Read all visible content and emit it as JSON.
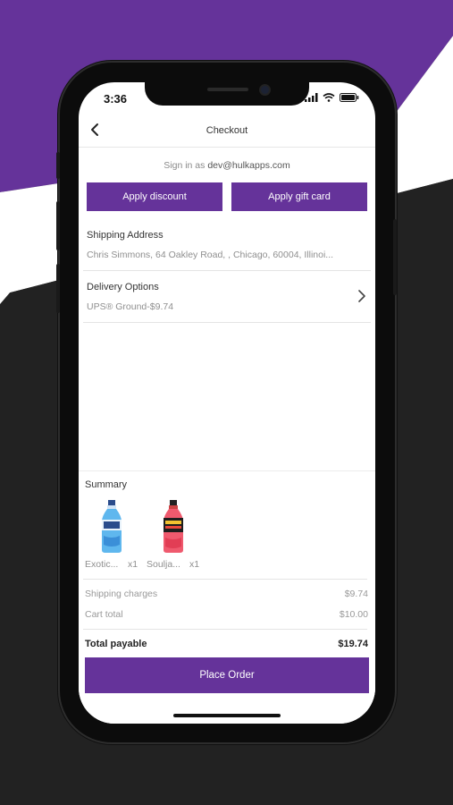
{
  "colors": {
    "accent": "#65339a",
    "background_dark": "#222222",
    "background_light": "#ffffff"
  },
  "status_bar": {
    "time": "3:36"
  },
  "nav": {
    "title": "Checkout",
    "back_icon": "chevron-left-icon"
  },
  "signin": {
    "prefix": "Sign in as",
    "email": "dev@hulkapps.com"
  },
  "buttons": {
    "apply_discount": "Apply discount",
    "apply_gift_card": "Apply gift card",
    "place_order": "Place Order"
  },
  "shipping": {
    "label": "Shipping Address",
    "value": "Chris Simmons, 64 Oakley Road, , Chicago, 60004, Illinoi..."
  },
  "delivery": {
    "label": "Delivery Options",
    "value": "UPS® Ground-$9.74"
  },
  "summary": {
    "title": "Summary",
    "products": [
      {
        "name": "Exotic...",
        "qty": "x1"
      },
      {
        "name": "Soulja...",
        "qty": "x1"
      }
    ],
    "rows": [
      {
        "label": "Shipping charges",
        "value": "$9.74"
      },
      {
        "label": "Cart total",
        "value": "$10.00"
      }
    ],
    "total": {
      "label": "Total payable",
      "value": "$19.74"
    }
  }
}
